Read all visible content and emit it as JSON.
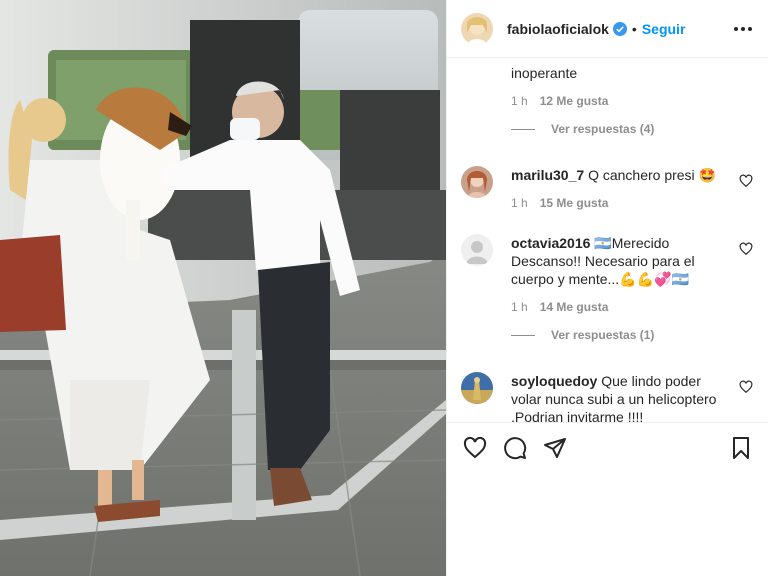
{
  "post": {
    "username": "fabiolaoficialok",
    "follow_label": "Seguir",
    "dot": "•"
  },
  "comments": [
    {
      "partial_text": "inoperante",
      "time": "1 h",
      "likes": "12 Me gusta",
      "replies": "Ver respuestas (4)"
    },
    {
      "username": "marilu30_7",
      "text": "Q canchero presi 🤩",
      "time": "1 h",
      "likes": "15 Me gusta"
    },
    {
      "username": "octavia2016",
      "text": "🇦🇷Merecido Descanso!! Necesario para el cuerpo y mente...💪💪💞🇦🇷",
      "time": "1 h",
      "likes": "14 Me gusta",
      "replies": "Ver respuestas (1)"
    },
    {
      "username": "soyloquedoy",
      "text": "Que lindo poder volar nunca subi a un helicoptero ,Podrian invitarme !!!!"
    }
  ],
  "colors": {
    "link": "#0095f6",
    "text": "#262626",
    "muted": "#8e8e8e",
    "border": "#efefef",
    "verified": "#3897f0"
  },
  "icons": {
    "like": "heart-icon",
    "comment": "comment-icon",
    "share": "paper-plane-icon",
    "save": "bookmark-icon",
    "more": "more-options-icon"
  }
}
